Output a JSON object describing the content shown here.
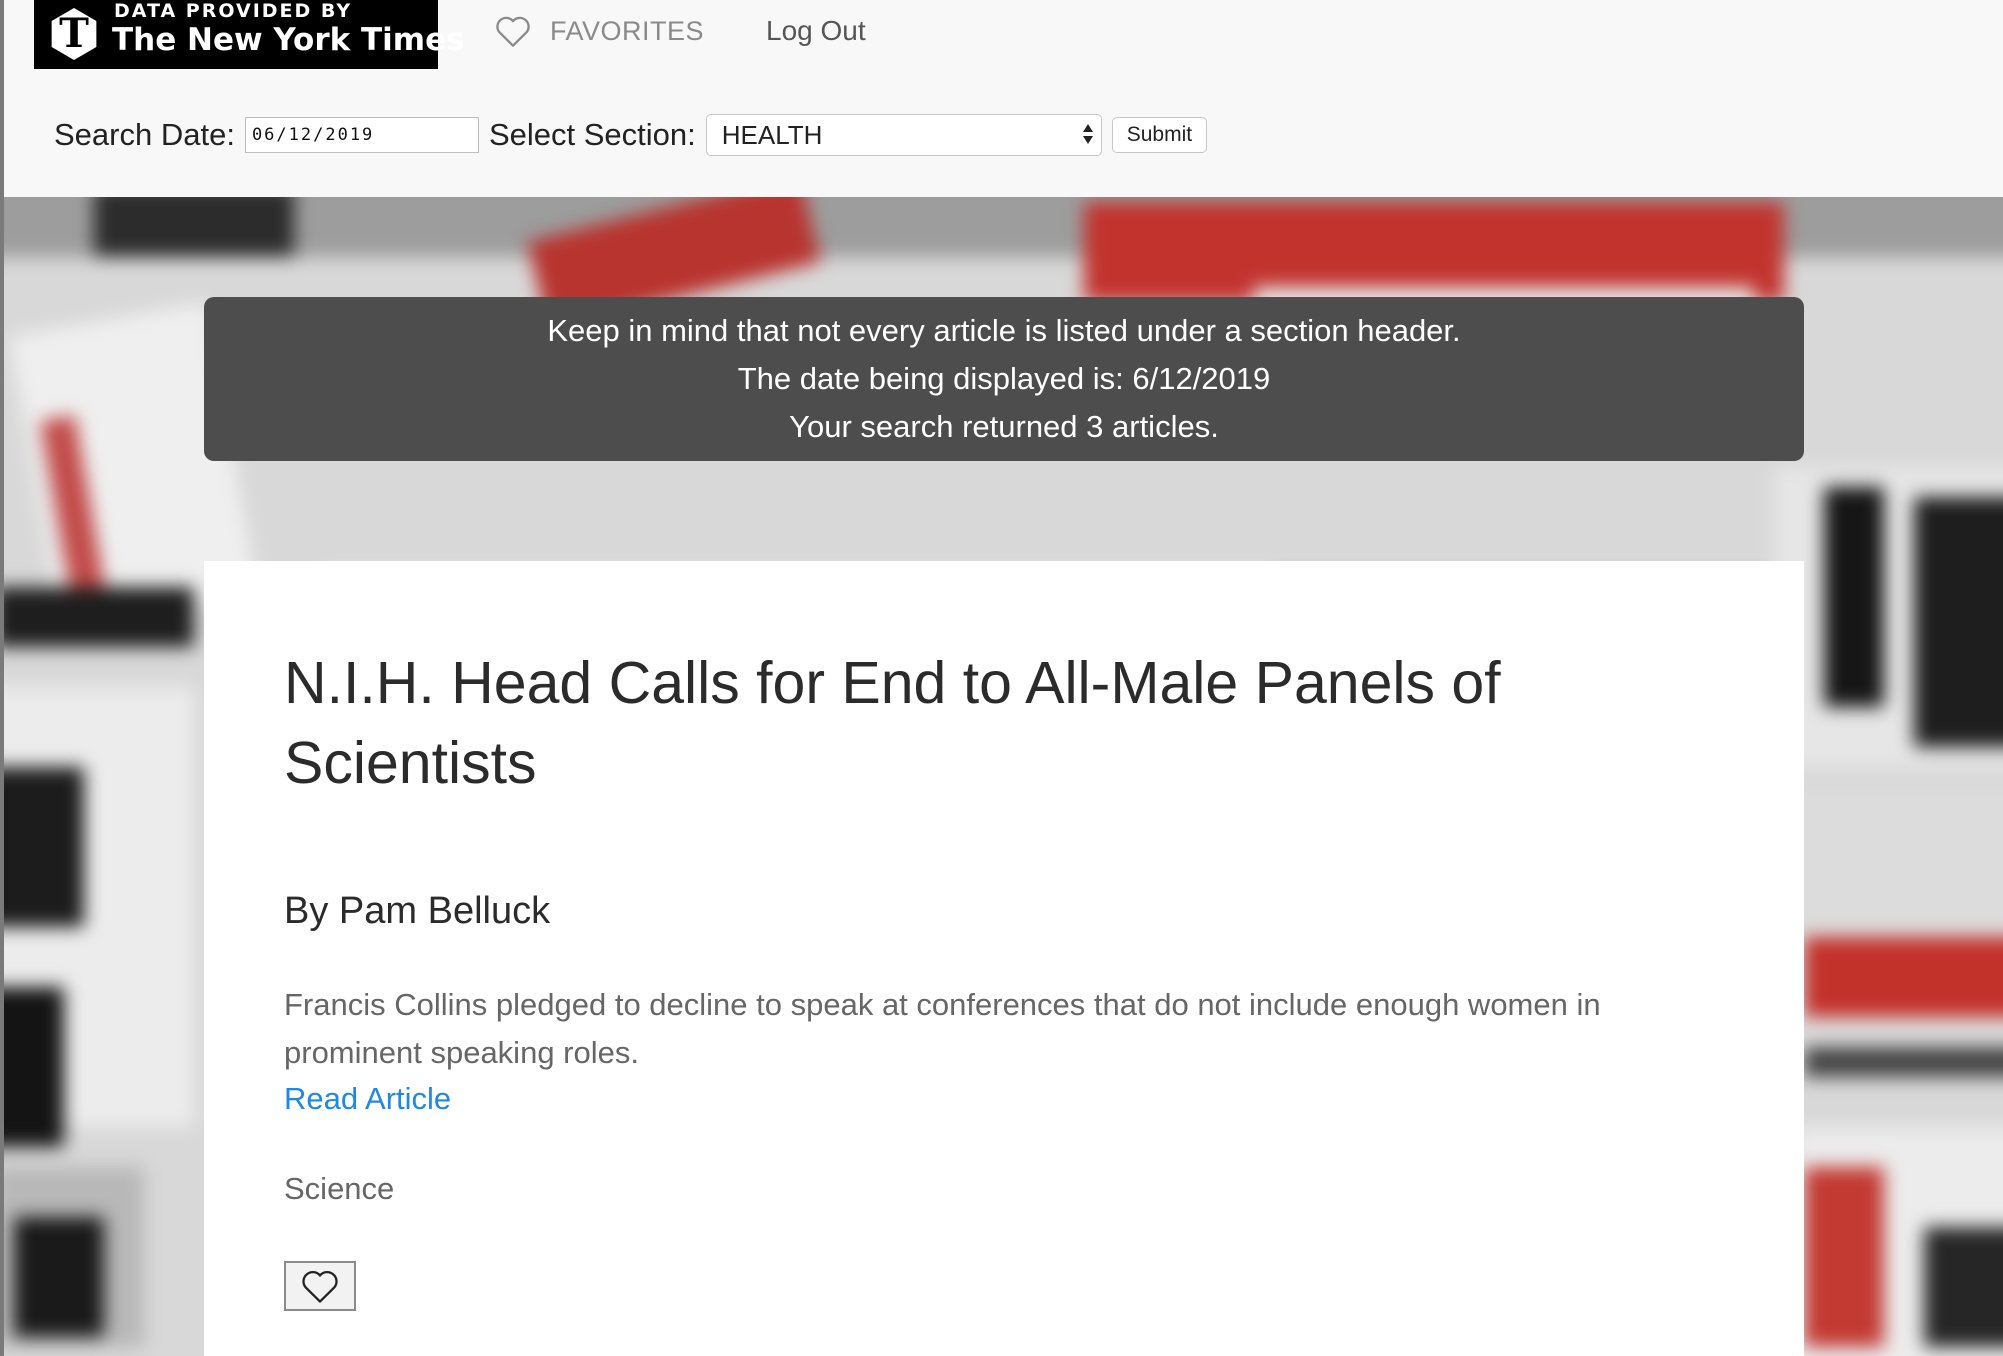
{
  "nav": {
    "logo_small": "DATA PROVIDED BY",
    "logo_big": "The New York Times",
    "logo_mark": "T",
    "favorites_label": "FAVORITES",
    "favorites_icon": "heart-outline-icon",
    "logout_label": "Log Out"
  },
  "search": {
    "date_label": "Search Date:",
    "date_value": "06/12/2019",
    "section_label": "Select Section:",
    "section_value": "HEALTH",
    "submit_label": "Submit"
  },
  "info": {
    "line1": "Keep in mind that not every article is listed under a section header.",
    "line2": "The date being displayed is: 6/12/2019",
    "line3": "Your search returned 3 articles."
  },
  "article": {
    "title": "N.I.H. Head Calls for End to All-Male Panels of Scientists",
    "byline": "By Pam Belluck",
    "abstract": "Francis Collins pledged to decline to speak at conferences that do not include enough women in prominent speaking roles.",
    "link_label": "Read Article",
    "section": "Science",
    "favorite_icon": "heart-outline-icon"
  },
  "colors": {
    "link": "#1e88e5",
    "info_bg": "#4d4d4d",
    "nav_bg": "#f8f8f8"
  }
}
